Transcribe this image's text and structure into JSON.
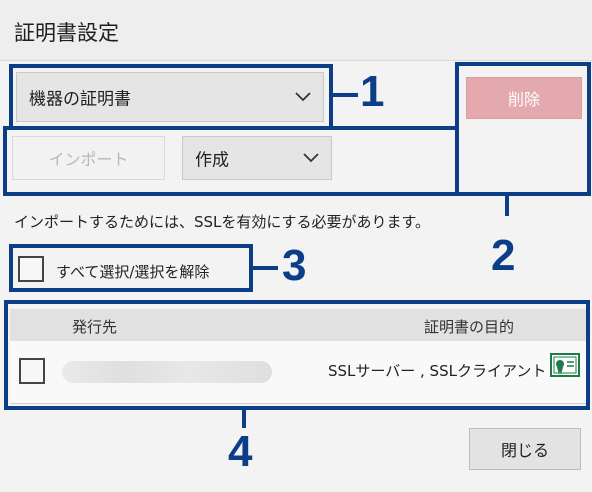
{
  "dialog": {
    "title": "証明書設定"
  },
  "cert_source_select": {
    "value": "機器の証明書"
  },
  "delete_button": {
    "label": "削除",
    "color": "#e3a9ae"
  },
  "import_button": {
    "label": "インポート"
  },
  "create_select": {
    "value": "作成"
  },
  "notice_text": "インポートするためには、SSLを有効にする必要があります。",
  "select_all": {
    "label": "すべて選択/選択を解除",
    "checked": false
  },
  "table": {
    "columns": [
      "発行先",
      "証明書の目的"
    ],
    "rows": [
      {
        "checked": false,
        "issued_to": "",
        "purpose": "SSLサーバー , SSLクライアント",
        "icon": "certificate-icon"
      }
    ]
  },
  "close_button": {
    "label": "閉じる"
  },
  "callouts": {
    "one": "1",
    "two": "2",
    "three": "3",
    "four": "4",
    "color": "#0b3e86"
  }
}
